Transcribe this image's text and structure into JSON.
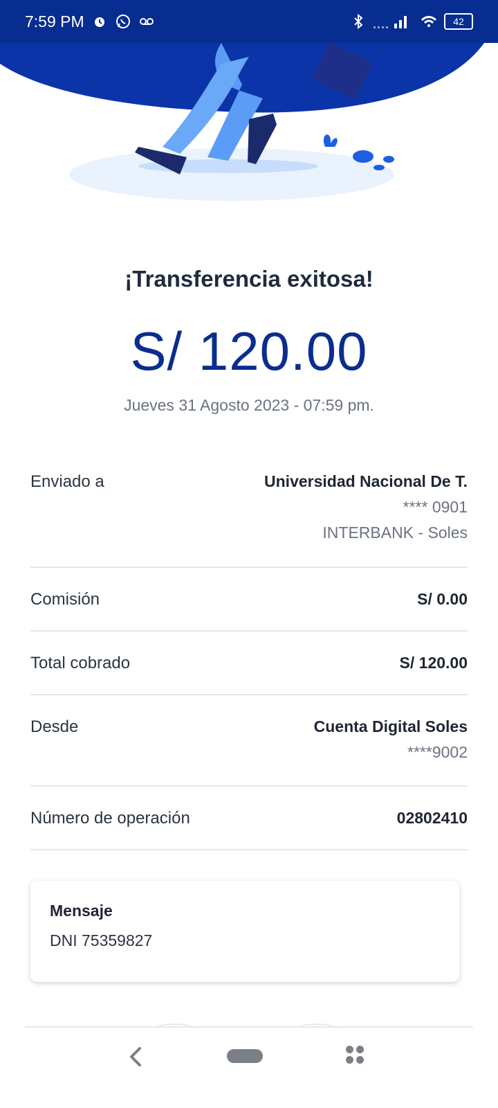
{
  "status_bar": {
    "time": "7:59 PM",
    "icons_left": [
      "alarm-icon",
      "whatsapp-icon",
      "voicemail-icon"
    ],
    "icons_right": [
      "bluetooth-icon",
      "signal-icon",
      "wifi-icon",
      "battery-icon"
    ],
    "battery": "42"
  },
  "result": {
    "title": "¡Transferencia exitosa!",
    "amount": "S/ 120.00",
    "datetime": "Jueves 31 Agosto 2023 - 07:59 pm."
  },
  "details": {
    "sent_to": {
      "label": "Enviado a",
      "name": "Universidad Nacional De T.",
      "account": "**** 0901",
      "bank": "INTERBANK - Soles"
    },
    "commission": {
      "label": "Comisión",
      "value": "S/ 0.00"
    },
    "total": {
      "label": "Total cobrado",
      "value": "S/ 120.00"
    },
    "from": {
      "label": "Desde",
      "account_name": "Cuenta Digital Soles",
      "account": "****9002"
    },
    "operation": {
      "label": "Número de operación",
      "value": "02802410"
    }
  },
  "message": {
    "title": "Mensaje",
    "body": "DNI 75359827"
  },
  "colors": {
    "brand": "#062d8f",
    "amount": "#0a2d8f",
    "illustration_blue": "#5b9cf6"
  }
}
